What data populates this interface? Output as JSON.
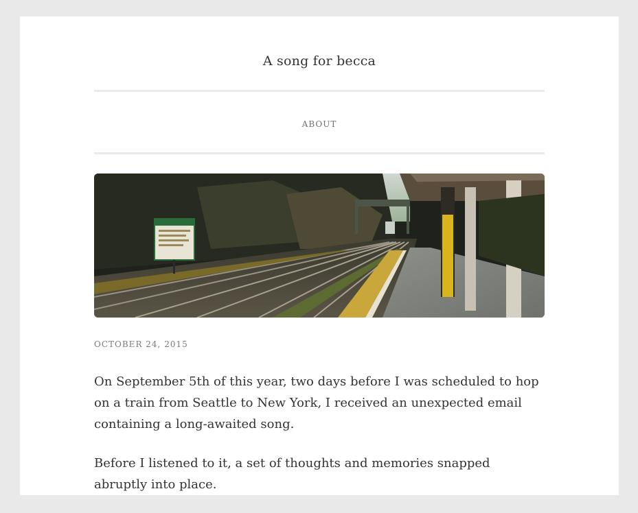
{
  "site": {
    "title": "A song for becca"
  },
  "nav": {
    "items": [
      {
        "label": "ABOUT"
      }
    ]
  },
  "post": {
    "date": "OCTOBER 24, 2015",
    "hero_image_description_icon": "train-station-photo",
    "sign_text": "NEWTON CENTRE",
    "paragraphs": [
      "On September 5th of this year, two days before I was scheduled to hop on a train from Seattle to New York, I received an unexpected email containing a long-awaited song.",
      "Before I listened to it, a set of thoughts and memories snapped abruptly into place."
    ]
  },
  "colors": {
    "background": "#e9e9e9",
    "card": "#ffffff",
    "text": "#333333",
    "muted": "#707070",
    "rule": "#eaeaea"
  }
}
